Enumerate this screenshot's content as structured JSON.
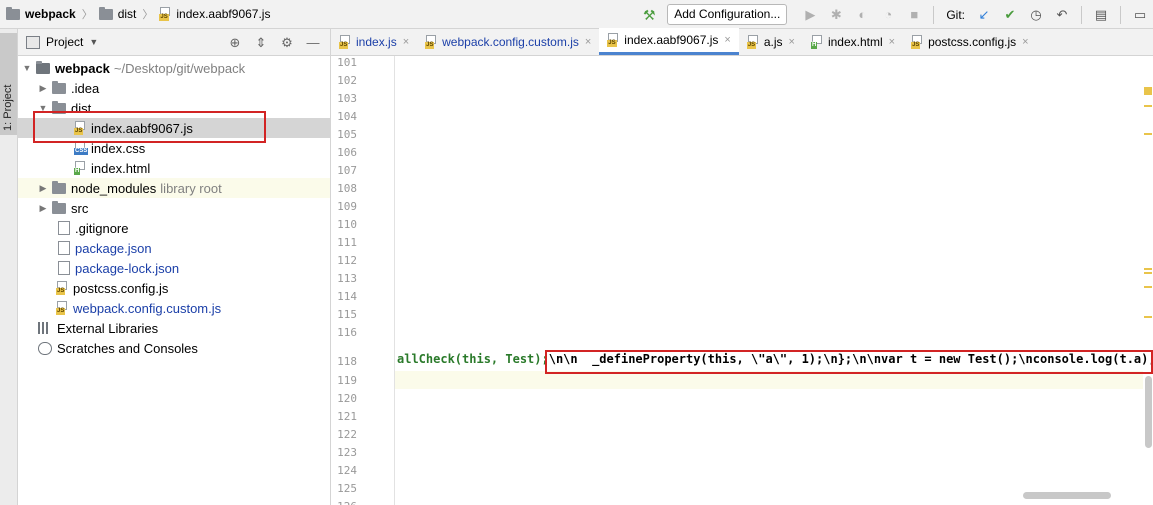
{
  "breadcrumb": {
    "project": "webpack",
    "folder": "dist",
    "file": "index.aabf9067.js"
  },
  "toolbar": {
    "add_configuration": "Add Configuration...",
    "git_label": "Git:",
    "icons": [
      "hammer-icon",
      "run-icon",
      "debug-icon",
      "coverage-icon",
      "profile-icon",
      "stop-icon",
      "git-update-icon",
      "git-commit-icon",
      "git-history-icon",
      "git-revert-icon",
      "project-structure-icon",
      "terminal-icon"
    ]
  },
  "left_stripe": {
    "tab_label": "1: Project"
  },
  "project_panel": {
    "title": "Project",
    "tree": [
      {
        "label": "webpack",
        "extra": "~/Desktop/git/webpack",
        "type": "root"
      },
      {
        "label": ".idea",
        "type": "folder"
      },
      {
        "label": "dist",
        "type": "folder"
      },
      {
        "label": "index.aabf9067.js",
        "type": "js"
      },
      {
        "label": "index.css",
        "type": "css"
      },
      {
        "label": "index.html",
        "type": "html"
      },
      {
        "label": "node_modules",
        "extra": "library root",
        "type": "folder"
      },
      {
        "label": "src",
        "type": "folder"
      },
      {
        "label": ".gitignore",
        "type": "git"
      },
      {
        "label": "package.json",
        "type": "json"
      },
      {
        "label": "package-lock.json",
        "type": "json"
      },
      {
        "label": "postcss.config.js",
        "type": "js"
      },
      {
        "label": "webpack.config.custom.js",
        "type": "js"
      },
      {
        "label": "External Libraries",
        "type": "lib"
      },
      {
        "label": "Scratches and Consoles",
        "type": "scratch"
      }
    ]
  },
  "editor": {
    "tabs": [
      {
        "label": "index.js"
      },
      {
        "label": "webpack.config.custom.js"
      },
      {
        "label": "index.aabf9067.js"
      },
      {
        "label": "a.js"
      },
      {
        "label": "index.html"
      },
      {
        "label": "postcss.config.js"
      }
    ],
    "line_numbers": [
      "101",
      "102",
      "103",
      "104",
      "105",
      "106",
      "107",
      "108",
      "109",
      "110",
      "111",
      "112",
      "113",
      "114",
      "115",
      "116",
      "118",
      "119",
      "120",
      "121",
      "122",
      "123",
      "124",
      "125",
      "126"
    ],
    "code": {
      "prefix": "allCheck(this, Test);",
      "highlighted": "\\n\\n  _defineProperty(this, \\\"a\\\", 1);\\n};\\n\\nvar t = new Test();\\nconsole.log(t.a);\\n"
    }
  },
  "colors": {
    "highlight_box": "#d22424",
    "code_green": "#2a7a2a",
    "tab_active_underline": "#4b83cf",
    "caret_row": "#fbfbea"
  }
}
